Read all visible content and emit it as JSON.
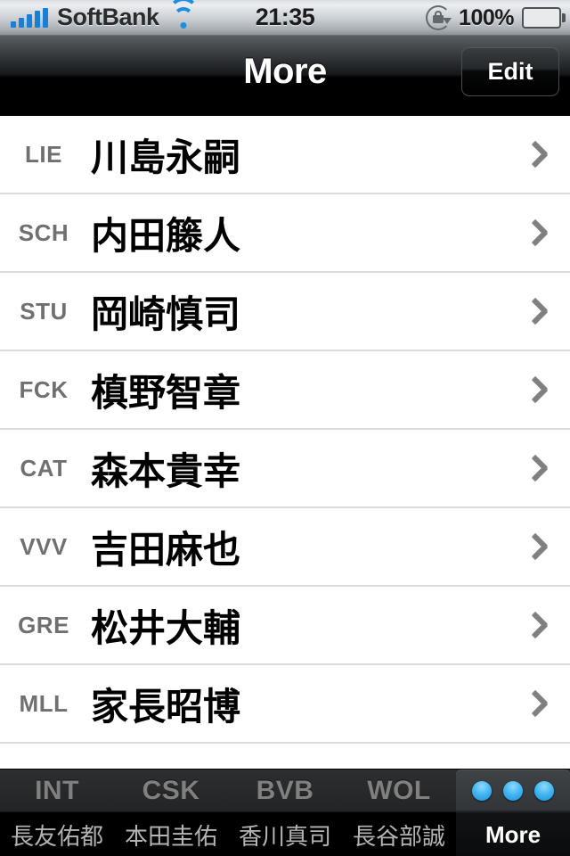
{
  "status_bar": {
    "carrier": "SoftBank",
    "signal_bars": 5,
    "wifi_icon": "wifi-icon",
    "time": "21:35",
    "rotation_lock_icon": "rotation-lock-icon",
    "battery_percent": "100%",
    "battery_level": 100,
    "battery_color": "#6fcd20"
  },
  "nav_bar": {
    "title": "More",
    "edit_label": "Edit"
  },
  "list": {
    "rows": [
      {
        "code": "LIE",
        "name": "川島永嗣"
      },
      {
        "code": "SCH",
        "name": "内田籐人"
      },
      {
        "code": "STU",
        "name": "岡崎慎司"
      },
      {
        "code": "FCK",
        "name": "槙野智章"
      },
      {
        "code": "CAT",
        "name": "森本貴幸"
      },
      {
        "code": "VVV",
        "name": "吉田麻也"
      },
      {
        "code": "GRE",
        "name": "松井大輔"
      },
      {
        "code": "MLL",
        "name": "家長昭博"
      }
    ],
    "disclosure_icon": "chevron-right-icon",
    "separator_color": "#dcdcdc"
  },
  "tab_bar": {
    "tabs": [
      {
        "code": "INT",
        "label": "長友佑都",
        "selected": false
      },
      {
        "code": "CSK",
        "label": "本田圭佑",
        "selected": false
      },
      {
        "code": "BVB",
        "label": "香川真司",
        "selected": false
      },
      {
        "code": "WOL",
        "label": "長谷部誠",
        "selected": false
      }
    ],
    "more": {
      "label": "More",
      "icon": "three-dots-icon",
      "dot_count": 3,
      "dot_color": "#42b6f2",
      "selected": true
    }
  }
}
